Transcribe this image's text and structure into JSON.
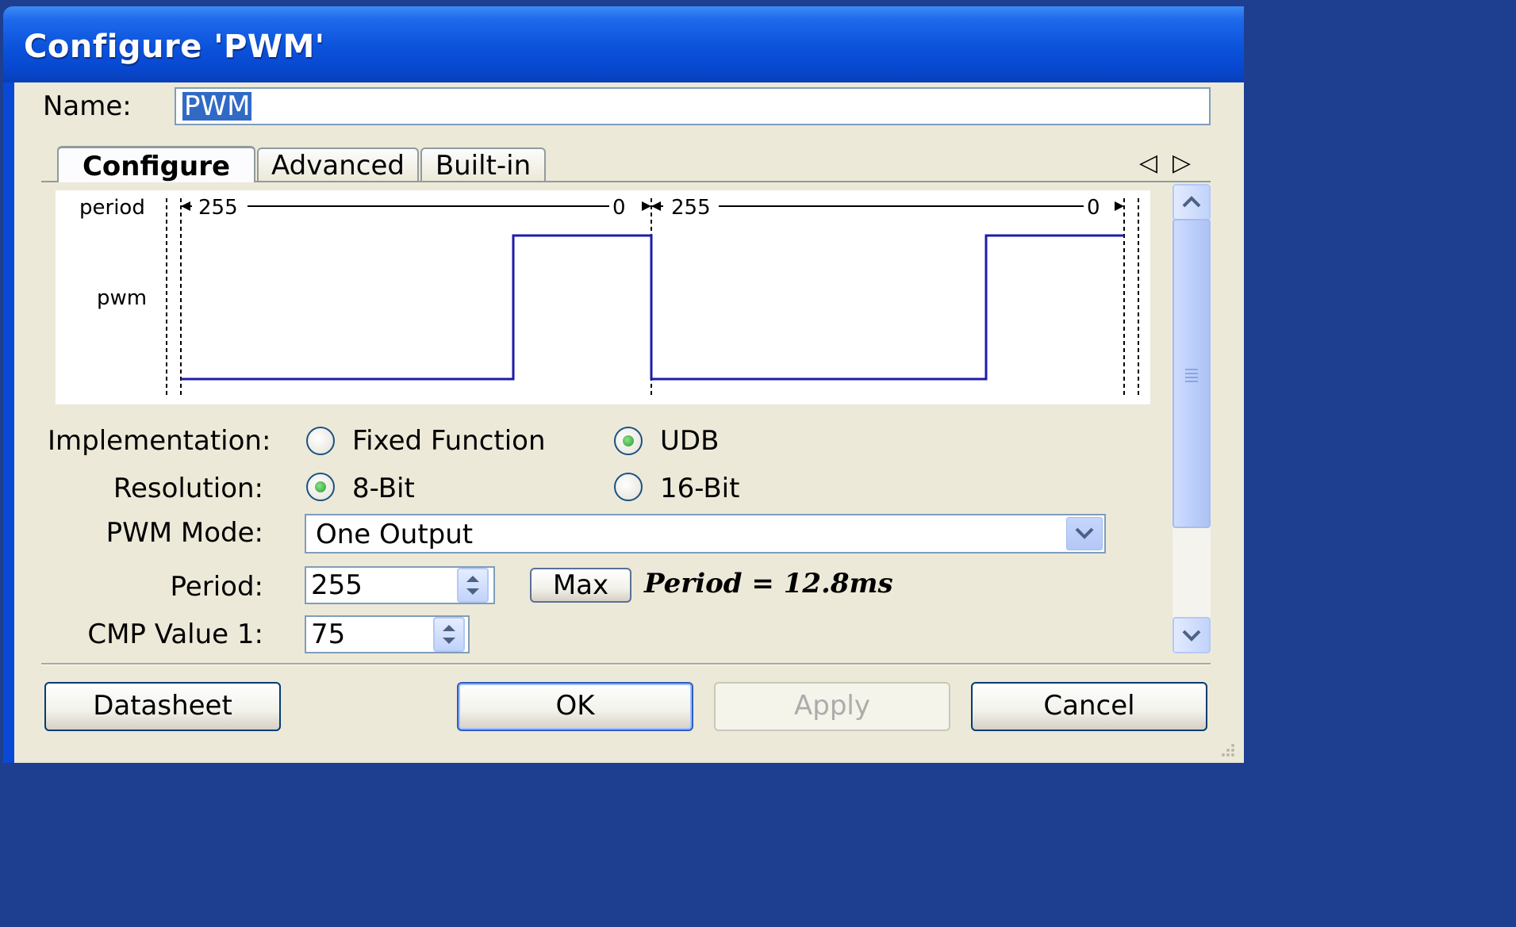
{
  "window": {
    "title": "Configure 'PWM'",
    "help_glyph": "?",
    "close_glyph": "✕"
  },
  "name_field": {
    "label": "Name:",
    "value": "PWM"
  },
  "tabs": [
    {
      "label": "Configure",
      "active": true
    },
    {
      "label": "Advanced",
      "active": false
    },
    {
      "label": "Built-in",
      "active": false
    }
  ],
  "diagram": {
    "period_label": "period",
    "pwm_label": "pwm",
    "period_marks": [
      "255",
      "0",
      "255",
      "0"
    ],
    "waveform_color": "#1c1ca8"
  },
  "implementation": {
    "label": "Implementation:",
    "options": [
      {
        "label": "Fixed Function",
        "selected": false
      },
      {
        "label": "UDB",
        "selected": true
      }
    ]
  },
  "resolution": {
    "label": "Resolution:",
    "options": [
      {
        "label": "8-Bit",
        "selected": true
      },
      {
        "label": "16-Bit",
        "selected": false
      }
    ]
  },
  "pwm_mode": {
    "label": "PWM Mode:",
    "value": "One Output"
  },
  "period": {
    "label": "Period:",
    "value": "255",
    "max_button": "Max",
    "info": "Period = 12.8ms"
  },
  "cmp_value_1": {
    "label": "CMP Value 1:",
    "value": "75"
  },
  "buttons": {
    "datasheet": "Datasheet",
    "ok": "OK",
    "apply": "Apply",
    "cancel": "Cancel"
  },
  "colors": {
    "titlebar": "#0b52da",
    "client": "#ece9d8",
    "selection": "#316ac5"
  }
}
